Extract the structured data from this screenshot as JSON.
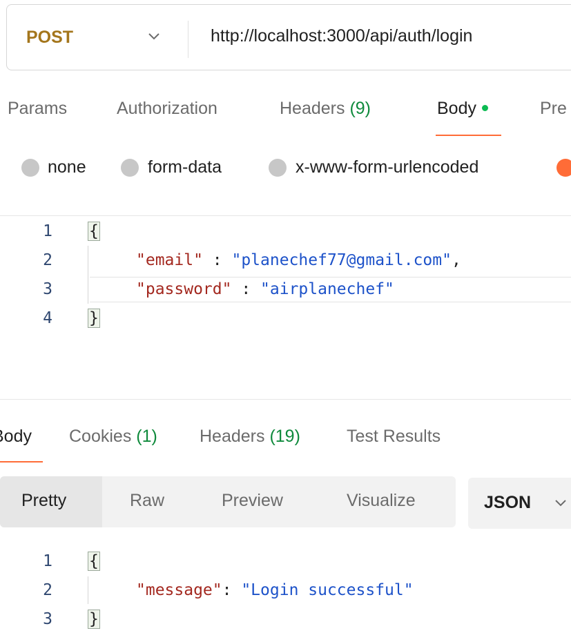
{
  "request": {
    "method": "POST",
    "url": "http://localhost:3000/api/auth/login",
    "tabs": [
      {
        "label": "Params",
        "count": ""
      },
      {
        "label": "Authorization",
        "count": ""
      },
      {
        "label": "Headers",
        "count": "(9)"
      },
      {
        "label": "Body",
        "count": ""
      },
      {
        "label": "Pre",
        "count": ""
      }
    ],
    "active_tab": "Body",
    "body_types": [
      "none",
      "form-data",
      "x-www-form-urlencoded"
    ],
    "editor": {
      "line_numbers": [
        "1",
        "2",
        "3",
        "4"
      ],
      "open_brace": "{",
      "close_brace": "}",
      "fields": [
        {
          "key": "\"email\"",
          "sep": " : ",
          "value": "\"planechef77@gmail.com\"",
          "trail": ","
        },
        {
          "key": "\"password\"",
          "sep": " : ",
          "value": "\"airplanechef\"",
          "trail": ""
        }
      ]
    }
  },
  "response": {
    "tabs": [
      {
        "label": "Body",
        "count": ""
      },
      {
        "label": "Cookies",
        "count": "(1)"
      },
      {
        "label": "Headers",
        "count": "(19)"
      },
      {
        "label": "Test Results",
        "count": ""
      }
    ],
    "active_tab": "Body",
    "view_modes": [
      "Pretty",
      "Raw",
      "Preview",
      "Visualize"
    ],
    "active_view": "Pretty",
    "format": "JSON",
    "editor": {
      "line_numbers": [
        "1",
        "2",
        "3"
      ],
      "open_brace": "{",
      "close_brace": "}",
      "fields": [
        {
          "key": "\"message\"",
          "sep": ": ",
          "value": "\"Login successful\"",
          "trail": ""
        }
      ]
    }
  },
  "colors": {
    "accent": "#ff6c37",
    "method": "#a4761c",
    "count": "#0f8a3c",
    "json_key": "#a3281f",
    "json_string": "#1d52c9"
  }
}
